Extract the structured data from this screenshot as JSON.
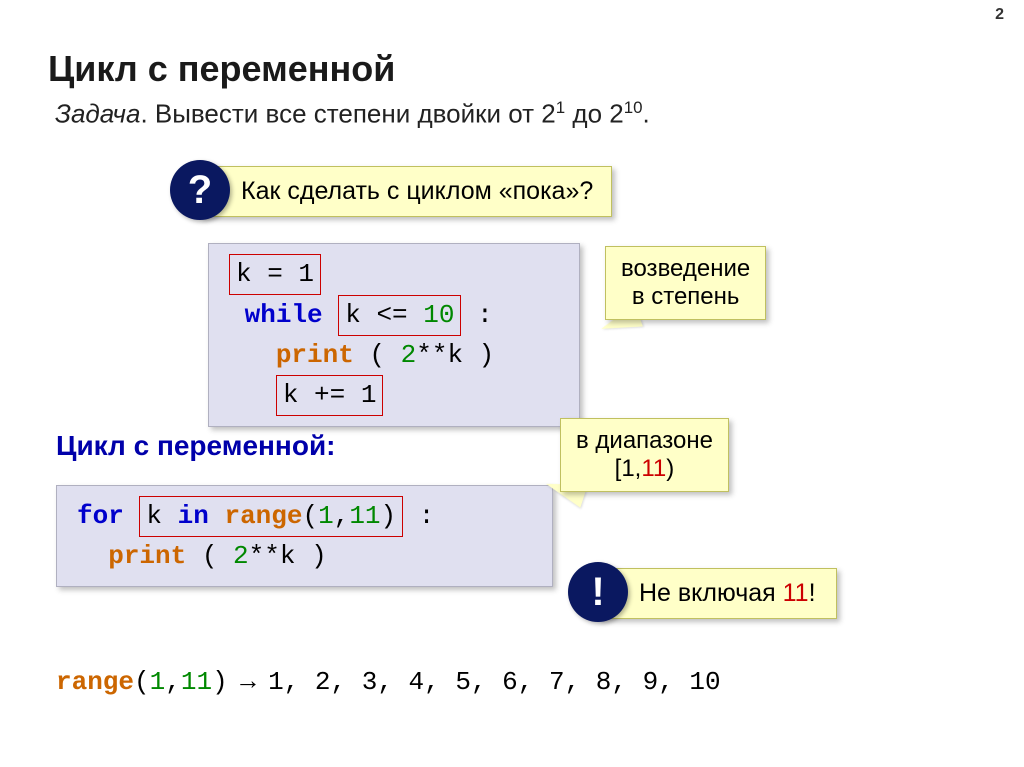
{
  "page_number": "2",
  "title": "Цикл с переменной",
  "task_label": "Задача",
  "task_text_a": ". Вывести все степени двойки от 2",
  "task_sup1": "1",
  "task_text_b": " до 2",
  "task_sup2": "10",
  "task_text_c": ".",
  "question_mark": "?",
  "question_text": "Как сделать с циклом «пока»?",
  "code1": {
    "l1_box": "k = 1",
    "l2_kw": "while",
    "l2_box_a": "k <= ",
    "l2_box_num": "10",
    "l2_colon": " :",
    "l3_fn": "print",
    "l3_open": " ( ",
    "l3_num": "2",
    "l3_rest": "**k )",
    "l4_box": "k += 1"
  },
  "callout1_l1": "возведение",
  "callout1_l2": "в степень",
  "subhead": "Цикл с переменной:",
  "callout2_l1": "в диапазоне",
  "callout2_l2a": "[1,",
  "callout2_l2b": "11",
  "callout2_l2c": ")",
  "code2": {
    "l1_kw": "for",
    "l1_box_a": "k ",
    "l1_box_kw": "in",
    "l1_box_fn": " range",
    "l1_box_open": "(",
    "l1_box_n1": "1",
    "l1_box_comma": ",",
    "l1_box_n2": "11",
    "l1_box_close": ")",
    "l1_colon": " :",
    "l2_fn": "print",
    "l2_open": " ( ",
    "l2_num": "2",
    "l2_rest": "**k )"
  },
  "excl_mark": "!",
  "excl_text_a": "Не включая ",
  "excl_num": "11",
  "excl_text_b": "!",
  "range": {
    "fn": "range",
    "open": "(",
    "n1": "1",
    "comma": ",",
    "n2": "11",
    "close": ")",
    "arrow": " → ",
    "seq": "1, 2, 3, 4, 5, 6, 7, 8, 9, 10"
  }
}
